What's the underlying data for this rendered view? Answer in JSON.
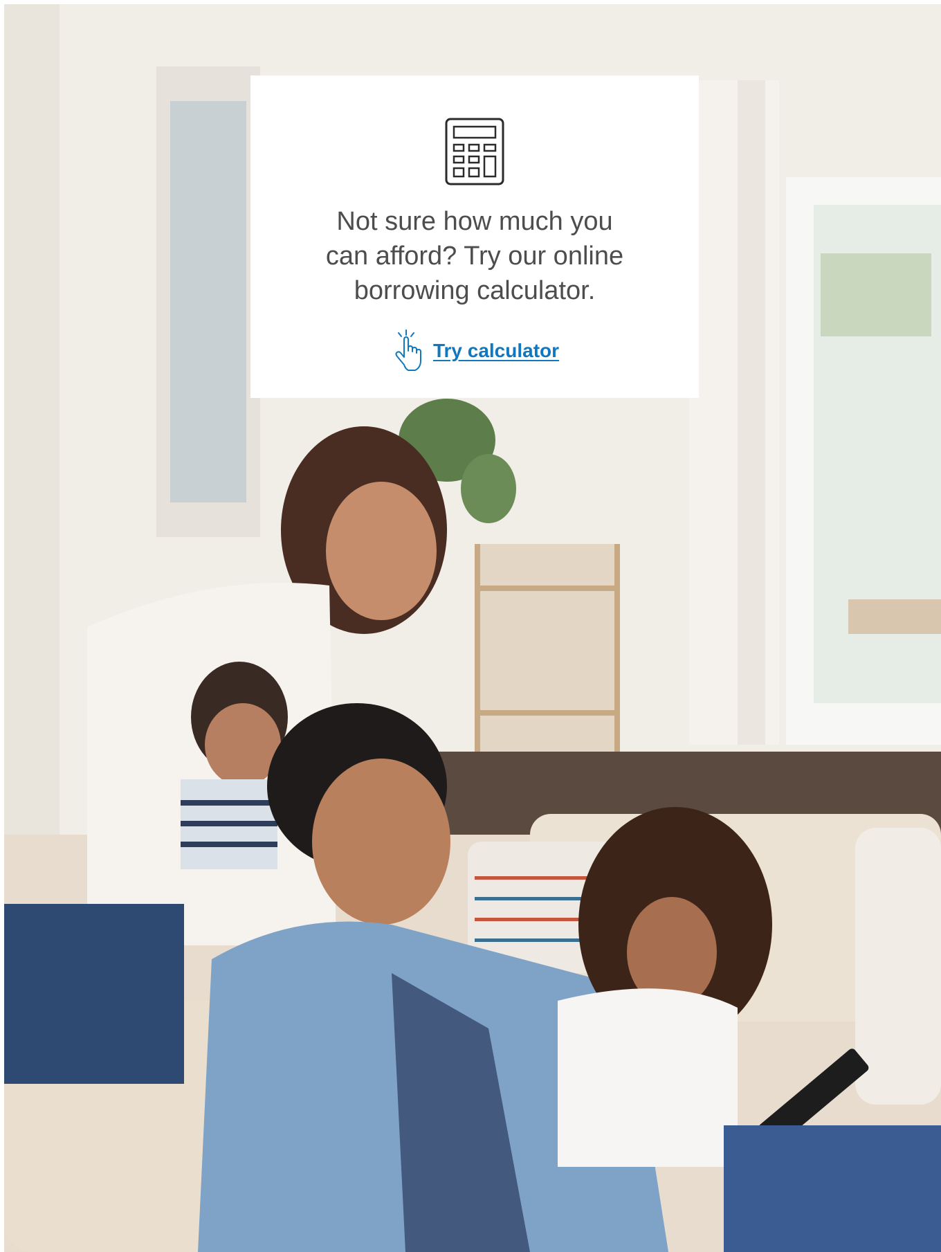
{
  "hero_image": {
    "description_icon": "family-on-sofa-photo"
  },
  "promo": {
    "icon": "calculator-icon",
    "text": "Not sure how much you can afford? Try our online borrowing calculator.",
    "cta_icon": "tap-hand-icon",
    "cta_label": "Try calculator",
    "cta_color": "#1178bf",
    "text_color": "#4d4d4d"
  }
}
